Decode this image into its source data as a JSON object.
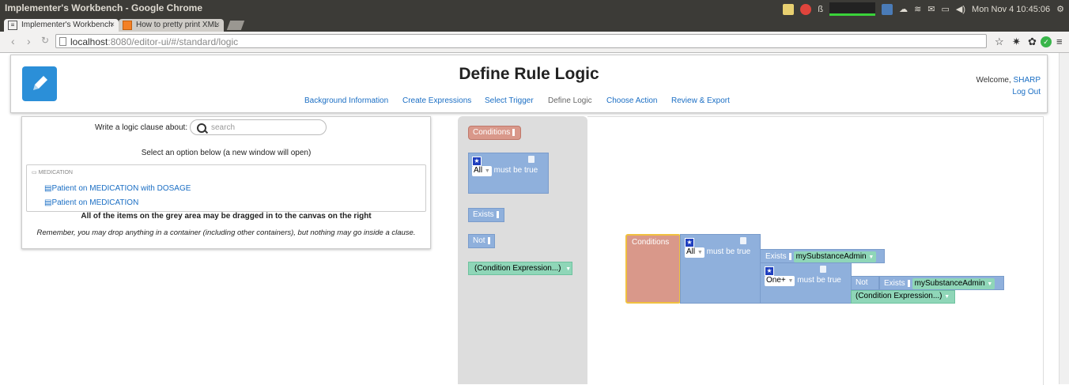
{
  "window": {
    "title": "Implementer's Workbench - Google Chrome"
  },
  "tray": {
    "clock": "Mon Nov 4 10:45:06"
  },
  "tabs": [
    {
      "label": "Implementer's Workbench",
      "active": true
    },
    {
      "label": "How to pretty print XML",
      "active": false
    }
  ],
  "address": {
    "host": "localhost",
    "rest": ":8080/editor-ui/#/standard/logic"
  },
  "header": {
    "title": "Define Rule Logic",
    "nav": [
      "Background Information",
      "Create Expressions",
      "Select Trigger",
      "Define Logic",
      "Choose Action",
      "Review & Export"
    ],
    "welcome_prefix": "Welcome, ",
    "user": "SHARP",
    "logout": "Log Out"
  },
  "left": {
    "write_label": "Write a logic clause about:",
    "search_placeholder": "search",
    "select_hint": "Select an option below (a new window will open)",
    "group_header": "MEDICATION",
    "options": [
      "Patient on MEDICATION with DOSAGE",
      "Patient on MEDICATION"
    ],
    "drag_note": "All of the items on the grey area may be dragged in to the canvas on the right",
    "drop_note": "Remember, you may drop anything in a container (including other containers), but nothing may go inside a clause."
  },
  "palette": {
    "conditions": "Conditions",
    "all": "All",
    "must_be_true": "must be true",
    "exists": "Exists",
    "not": "Not",
    "condition_expr": "(Condition Expression...)"
  },
  "canvas": {
    "conditions": "Conditions",
    "all": "All",
    "must_be_true": "must be true",
    "exists": "Exists",
    "substance": "mySubstanceAdmin",
    "one_plus": "One+",
    "must_be_true2": "must be true",
    "not": "Not",
    "exists2": "Exists",
    "substance2": "mySubstanceAdmin",
    "condition_expr": "(Condition Expression...)"
  },
  "colors": {
    "link": "#1a6ec4",
    "conditions_block": "#d9988a",
    "logic_block": "#8fb0dc",
    "expression_block": "#8fd6b8",
    "logo": "#2b8fd8"
  }
}
